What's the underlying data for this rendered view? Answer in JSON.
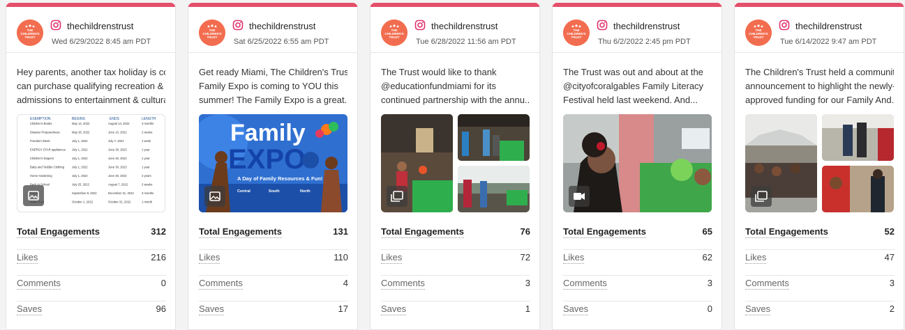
{
  "posts": [
    {
      "username": "thechildrenstrust",
      "timestamp": "Wed 6/29/2022 8:45 am PDT",
      "caption": "Hey parents, another tax holiday is coming and you can purchase qualifying recreation & other admissions to entertainment & cultural",
      "caption_lines": [
        "Hey parents, another tax holiday is com",
        "can purchase qualifying recreation & o",
        "admissions to entertainment & cultural"
      ],
      "media_type": "image",
      "media_icon": "image-icon",
      "stats": {
        "total_engagements": "312",
        "likes": "216",
        "comments": "0",
        "saves": "96"
      }
    },
    {
      "username": "thechildrenstrust",
      "timestamp": "Sat 6/25/2022 6:55 am PDT",
      "caption_lines": [
        "Get ready Miami, The Children's Trust",
        "Family Expo is coming to YOU this",
        "summer! The Family Expo is a great..."
      ],
      "media_type": "image",
      "media_icon": "image-icon",
      "stats": {
        "total_engagements": "131",
        "likes": "110",
        "comments": "4",
        "saves": "17"
      }
    },
    {
      "username": "thechildrenstrust",
      "timestamp": "Tue 6/28/2022 11:56 am PDT",
      "caption_lines": [
        "The Trust would like to thank",
        "@educationfundmiami for its",
        "continued partnership with the annu..."
      ],
      "media_type": "carousel",
      "media_icon": "gallery-icon",
      "stats": {
        "total_engagements": "76",
        "likes": "72",
        "comments": "3",
        "saves": "1"
      }
    },
    {
      "username": "thechildrenstrust",
      "timestamp": "Thu 6/2/2022 2:45 pm PDT",
      "caption_lines": [
        "The Trust was out and about at the",
        "@cityofcoralgables Family Literacy",
        "Festival held last weekend. And..."
      ],
      "media_type": "video",
      "media_icon": "video-icon",
      "stats": {
        "total_engagements": "65",
        "likes": "62",
        "comments": "3",
        "saves": "0"
      }
    },
    {
      "username": "thechildrenstrust",
      "timestamp": "Tue 6/14/2022 9:47 am PDT",
      "caption_lines": [
        "The Children's Trust held a community",
        "announcement to highlight the newly-",
        "approved funding for our Family And..."
      ],
      "media_type": "carousel",
      "media_icon": "gallery-icon",
      "stats": {
        "total_engagements": "52",
        "likes": "47",
        "comments": "3",
        "saves": "2"
      }
    }
  ],
  "labels": {
    "total_engagements": "Total Engagements",
    "likes": "Likes",
    "comments": "Comments",
    "saves": "Saves"
  },
  "flyer": {
    "title1": "Family",
    "title2": "EXPO",
    "subtitle": "A Day of Family Resources & Fun!",
    "locations": [
      "Central",
      "South",
      "North"
    ]
  },
  "tax_table": {
    "headers": [
      "EXEMPTION",
      "BEGINS",
      "ENDS",
      "LENGTH"
    ],
    "rows": [
      [
        "Children's Books",
        "May 14, 2022",
        "August 14, 2022",
        "3 months"
      ],
      [
        "Disaster Preparedness",
        "May 28, 2022",
        "June 10, 2022",
        "2 weeks"
      ],
      [
        "Freedom Week",
        "July 1, 2022",
        "July 7, 2022",
        "1 week"
      ],
      [
        "ENERGY STAR appliances",
        "July 1, 2022",
        "June 30, 2023",
        "1 year"
      ],
      [
        "Children's Diapers",
        "July 1, 2022",
        "June 30, 2023",
        "1 year"
      ],
      [
        "Baby and Toddler Clothing",
        "July 1, 2022",
        "June 30, 2023",
        "1 year"
      ],
      [
        "Home Hardening",
        "July 1, 2022",
        "June 30, 2024",
        "2 years"
      ],
      [
        "Back to School",
        "July 25, 2022",
        "August 7, 2022",
        "2 weeks"
      ],
      [
        "Fishing",
        "September 8, 2022",
        "December 31, 2022",
        "3 months"
      ],
      [
        "Motor Fuel",
        "October 1, 2022",
        "October 31, 2022",
        "1 month"
      ]
    ]
  },
  "colors": {
    "accent": "#e4506b",
    "avatar": "#f26d4f",
    "instagram": "#e1306c"
  }
}
